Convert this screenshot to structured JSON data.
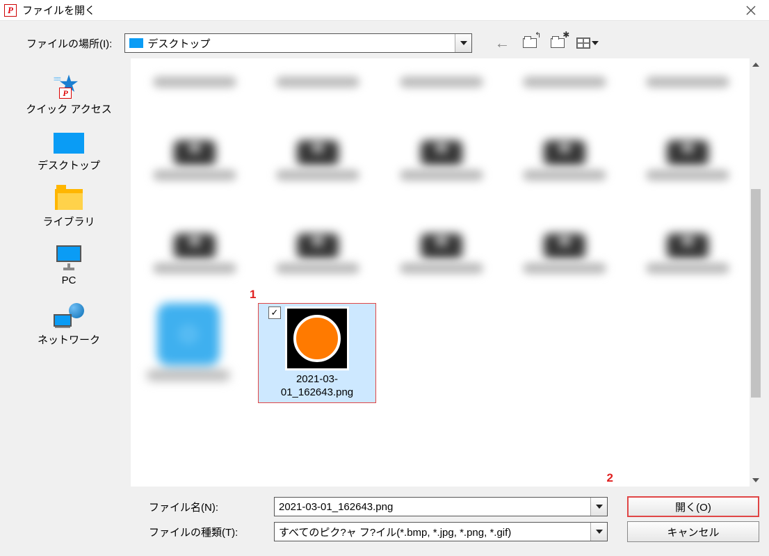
{
  "titlebar": {
    "title": "ファイルを開く"
  },
  "location": {
    "label": "ファイルの場所(I):",
    "selected": "デスクトップ"
  },
  "places": [
    {
      "label": "クイック アクセス"
    },
    {
      "label": "デスクトップ"
    },
    {
      "label": "ライブラリ"
    },
    {
      "label": "PC"
    },
    {
      "label": "ネットワーク"
    }
  ],
  "selected_file": {
    "name": "2021-03-01_162643.png"
  },
  "annotations": {
    "a1": "1",
    "a2": "2"
  },
  "bottom": {
    "filename_label": "ファイル名(N):",
    "filename_value": "2021-03-01_162643.png",
    "filetype_label": "ファイルの種類(T):",
    "filetype_value": "すべてのピク?ャ フ?イル(*.bmp, *.jpg, *.png, *.gif)",
    "open": "開く(O)",
    "cancel": "キャンセル"
  }
}
